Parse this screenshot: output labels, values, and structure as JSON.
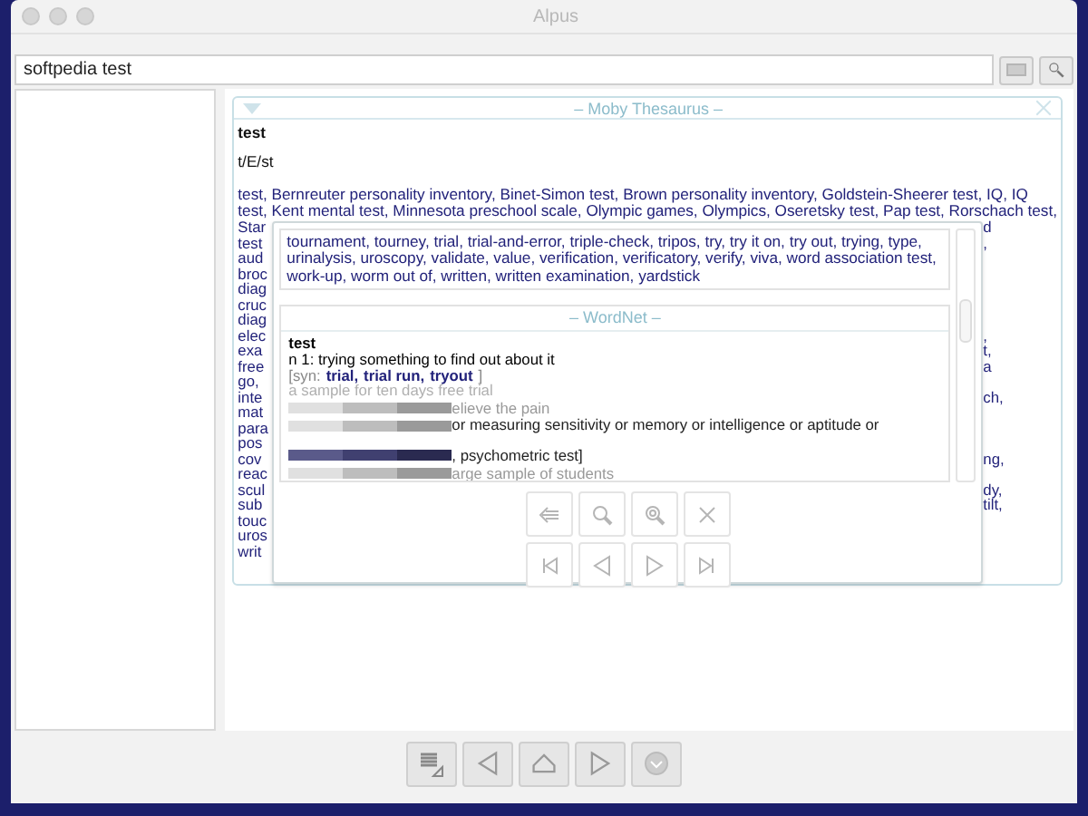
{
  "window": {
    "title": "Alpus"
  },
  "search": {
    "value": "softpedia test"
  },
  "moby": {
    "title": "– Moby Thesaurus –",
    "headword": "test",
    "pronunciation": "t/E/st",
    "lines": [
      "test, Bernreuter personality inventory, Binet-Simon test, Brown personality inventory, Goldstein-Sheerer test, IQ, IQ",
      "test, Kent mental test, Minnesota preschool scale, Olympic games, Olympics, Oseretsky test, Pap test, Rorschach test,"
    ],
    "rows": [
      {
        "left": "Star",
        "right": "d"
      },
      {
        "left": "test",
        "right": ","
      },
      {
        "left": "aud"
      },
      {
        "left": "broc"
      },
      {
        "left": "diag"
      },
      {
        "left": "cruc"
      },
      {
        "left": "diag"
      },
      {
        "left": "elec",
        "right": ","
      },
      {
        "left": "exa",
        "right": "t,"
      },
      {
        "left": "free",
        "right": "a"
      },
      {
        "left": "go,"
      },
      {
        "left": "inte",
        "right": "ch,"
      },
      {
        "left": "mat"
      },
      {
        "left": "para"
      },
      {
        "left": "pos"
      },
      {
        "left": "cov",
        "right": "ng,"
      },
      {
        "left": "reac"
      },
      {
        "left": "scul",
        "right": "dy,"
      },
      {
        "left": "sub",
        "right": "tilt,"
      },
      {
        "left": "touc"
      },
      {
        "left": "uros"
      },
      {
        "left": "writ"
      }
    ]
  },
  "popup": {
    "moby_text": "tournament, tourney, trial, trial-and-error, triple-check, tripos, try, try it on, try out, trying, type, urinalysis, uroscopy, validate, value, verification, verificatory, verify, viva, word association test, work-up, worm out of, written, written examination, yardstick",
    "wordnet": {
      "title": "– WordNet –",
      "headword": "test",
      "sense": "n 1: trying something to find out about it",
      "syn_open": "[syn:",
      "synonyms": [
        "trial,",
        "trial run,",
        "tryout"
      ],
      "syn_close": "]",
      "example": "a sample for ten days free trial",
      "partial_lines": [
        {
          "text": "elieve the pain",
          "muted": true
        },
        {
          "text": "or measuring sensitivity or memory or intelligence or aptitude or",
          "muted": false
        },
        {
          "text": ", psychometric test]",
          "muted": false
        },
        {
          "text": "arge sample of students",
          "muted": true
        }
      ]
    }
  }
}
